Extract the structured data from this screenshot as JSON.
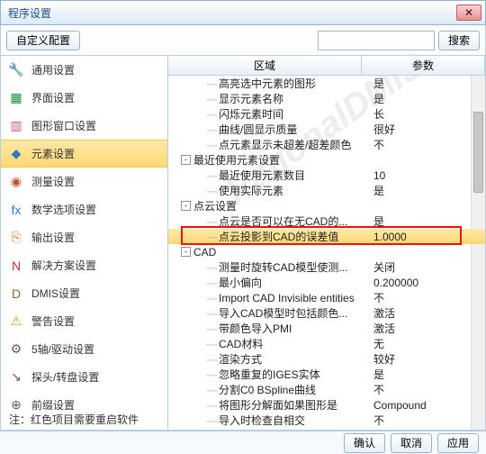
{
  "title": "程序设置",
  "toolbar": {
    "customize": "自定义配置",
    "search_placeholder": "",
    "search_btn": "搜索"
  },
  "sidebar": {
    "items": [
      {
        "icon": "🔧",
        "label": "通用设置",
        "color": "#d4a020"
      },
      {
        "icon": "▦",
        "label": "界面设置",
        "color": "#1a8a3a"
      },
      {
        "icon": "▥",
        "label": "图形窗口设置",
        "color": "#c05a8a"
      },
      {
        "icon": "◆",
        "label": "元素设置",
        "color": "#2a7ac0",
        "selected": true
      },
      {
        "icon": "◉",
        "label": "测量设置",
        "color": "#c0502a"
      },
      {
        "icon": "fx",
        "label": "数学选项设置",
        "color": "#2a7ac0"
      },
      {
        "icon": "⎘",
        "label": "输出设置",
        "color": "#d08030"
      },
      {
        "icon": "N",
        "label": "解决方案设置",
        "color": "#c03030"
      },
      {
        "icon": "D",
        "label": "DMIS设置",
        "color": "#8a6a30"
      },
      {
        "icon": "⚠",
        "label": "警告设置",
        "color": "#d0a020"
      },
      {
        "icon": "⚙",
        "label": "5轴/驱动设置",
        "color": "#606060"
      },
      {
        "icon": "↘",
        "label": "探头/转盘设置",
        "color": "#7a4a9a"
      },
      {
        "icon": "⊕",
        "label": "前缀设置",
        "color": "#606060"
      }
    ]
  },
  "tree": {
    "header_area": "区域",
    "header_param": "参数",
    "rows": [
      {
        "indent": 40,
        "label": "高亮选中元素的图形",
        "value": "是"
      },
      {
        "indent": 40,
        "label": "显示元素名称",
        "value": "是"
      },
      {
        "indent": 40,
        "label": "闪烁元素时间",
        "value": "长"
      },
      {
        "indent": 40,
        "label": "曲线/圆显示质量",
        "value": "很好"
      },
      {
        "indent": 40,
        "label": "点元素显示未超差/超差颜色",
        "value": "不"
      },
      {
        "indent": 14,
        "exp": "-",
        "label": "最近使用元素设置"
      },
      {
        "indent": 40,
        "label": "最近使用元素数目",
        "value": "10"
      },
      {
        "indent": 40,
        "label": "使用实际元素",
        "value": "是"
      },
      {
        "indent": 14,
        "exp": "-",
        "label": "点云设置"
      },
      {
        "indent": 40,
        "label": "点云是否可以在无CAD的...",
        "value": "是"
      },
      {
        "indent": 40,
        "label": "点云投影到CAD的误差值",
        "value": "1.0000",
        "highlight": true
      },
      {
        "indent": 14,
        "exp": "-",
        "label": "CAD"
      },
      {
        "indent": 40,
        "label": "测量时旋转CAD模型使测...",
        "value": "关闭"
      },
      {
        "indent": 40,
        "label": "最小偏向",
        "value": "0.200000"
      },
      {
        "indent": 40,
        "label": "Import CAD Invisible entities",
        "value": "不"
      },
      {
        "indent": 40,
        "label": "导入CAD模型时包括颜色...",
        "value": "激活"
      },
      {
        "indent": 40,
        "label": "带颜色导入PMI",
        "value": "激活"
      },
      {
        "indent": 40,
        "label": "CAD材料",
        "value": "无"
      },
      {
        "indent": 40,
        "label": "渲染方式",
        "value": "较好"
      },
      {
        "indent": 40,
        "label": "忽略重复的IGES实体",
        "value": "是"
      },
      {
        "indent": 40,
        "label": "分割C0 BSpline曲线",
        "value": "不"
      },
      {
        "indent": 40,
        "label": "将图形分解面如果图形是",
        "value": "Compound"
      },
      {
        "indent": 40,
        "label": "导入时检查自相交",
        "value": "不"
      }
    ]
  },
  "buttons": {
    "ok": "确认",
    "cancel": "取消",
    "apply": "应用"
  },
  "footnote": "注：红色项目需要重启软件",
  "watermark": "RationalDMIS"
}
